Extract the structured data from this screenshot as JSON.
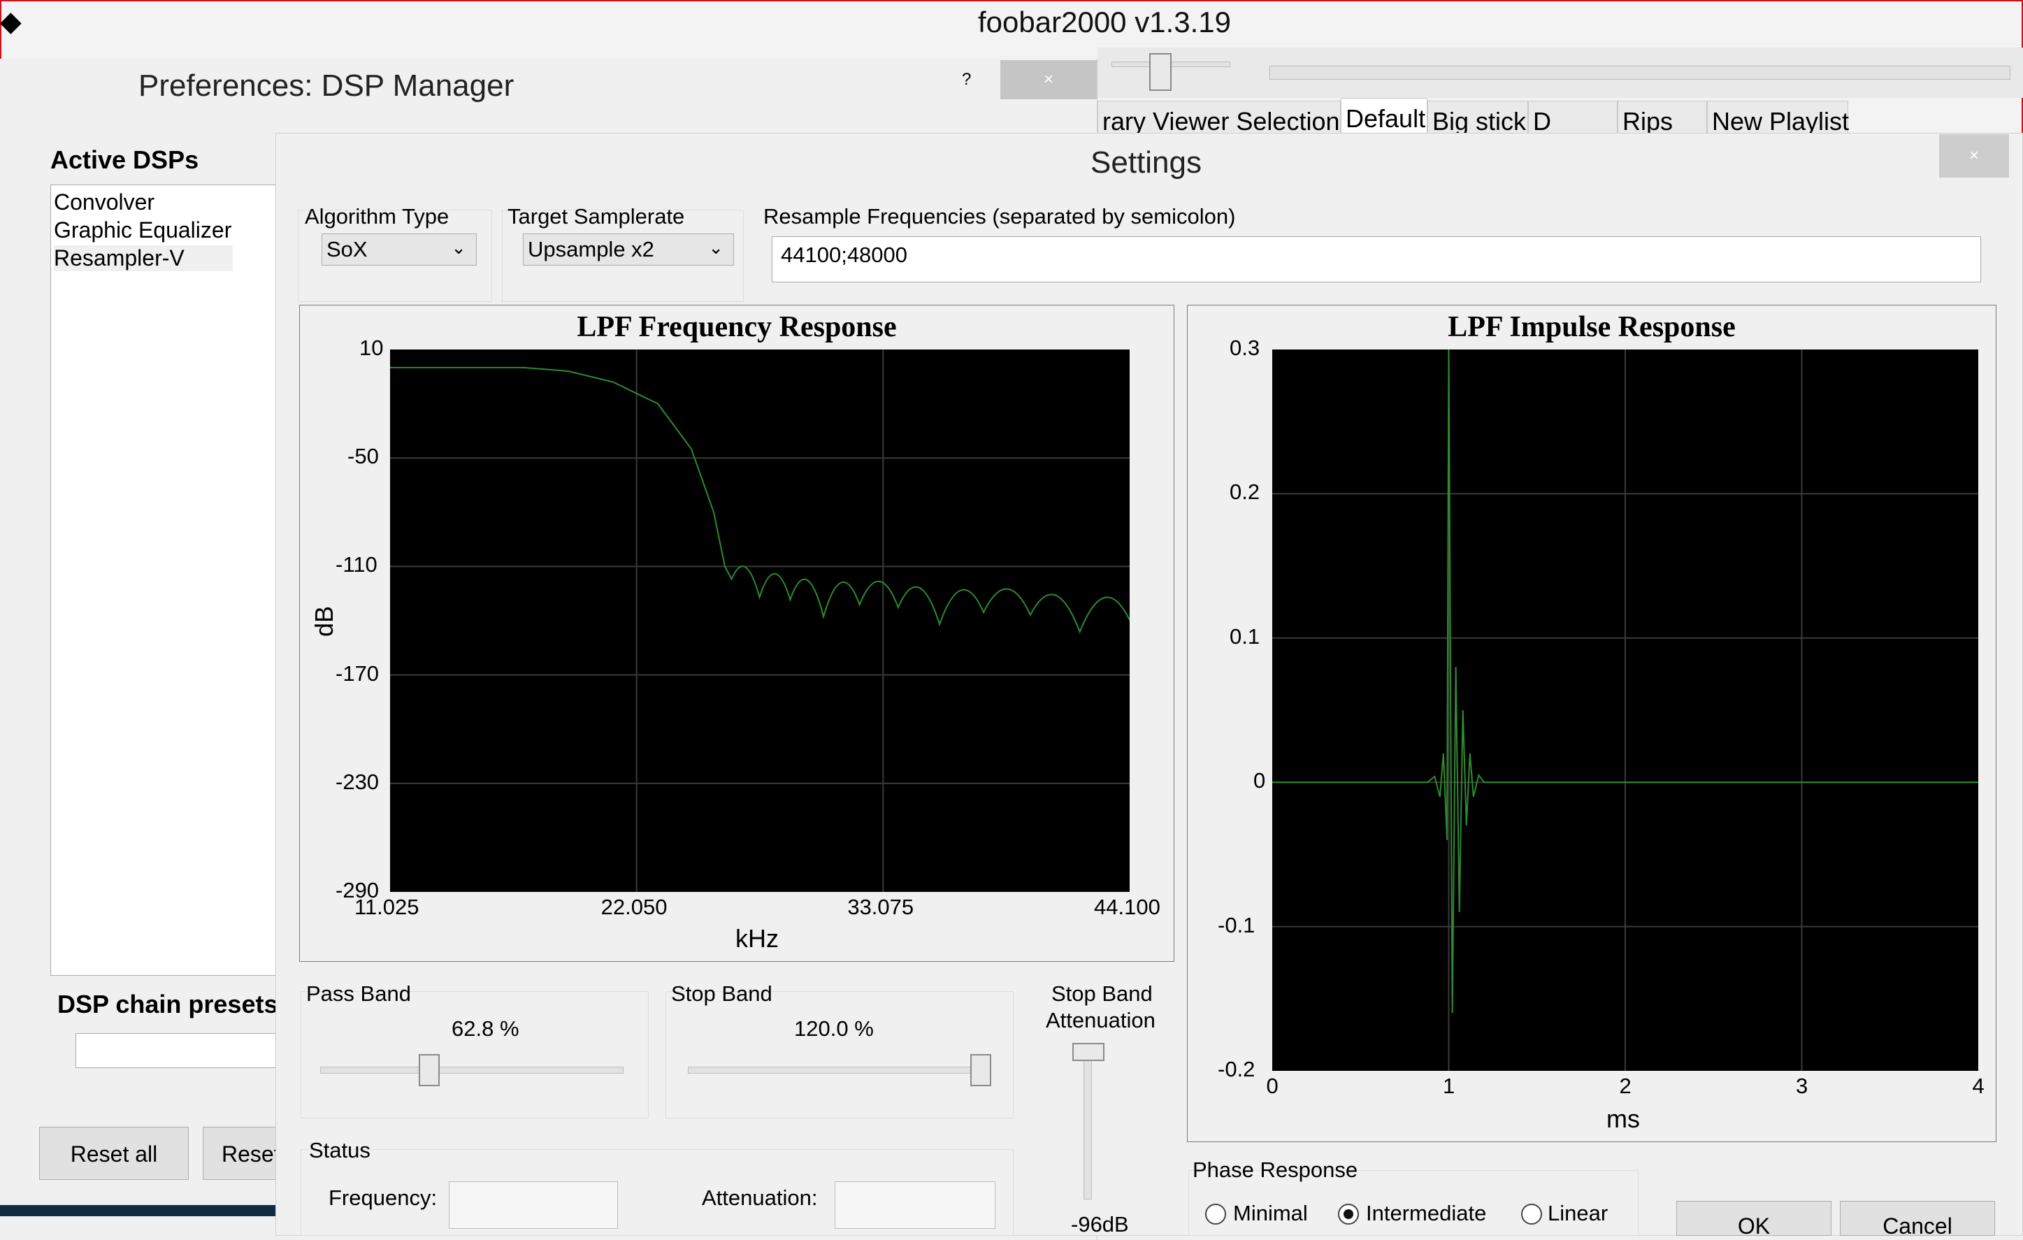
{
  "app": {
    "title": "foobar2000 v1.3.19"
  },
  "playlist_tabs": [
    "rary Viewer Selection",
    "Default",
    "Big stick",
    "D",
    "Rips",
    "New Playlist"
  ],
  "prefs": {
    "title": "Preferences: DSP Manager",
    "help": "?",
    "close": "×",
    "active_dsps_label": "Active DSPs",
    "active_dsps": [
      "Convolver",
      "Graphic Equalizer",
      "Resampler-V"
    ],
    "presets_label": "DSP chain presets",
    "reset_all": "Reset all",
    "reset": "Reset"
  },
  "settings": {
    "title": "Settings",
    "close": "×",
    "algorithm_label": "Algorithm Type",
    "algorithm_value": "SoX",
    "target_label": "Target Samplerate",
    "target_value": "Upsample x2",
    "resample_label": "Resample Frequencies (separated by semicolon)",
    "resample_value": "44100;48000",
    "pass_band_label": "Pass Band",
    "pass_band_value": "62.8 %",
    "pass_band_level": 0.35,
    "stop_band_label": "Stop Band",
    "stop_band_value": "120.0 %",
    "stop_band_level": 1.0,
    "attenuation_label_1": "Stop Band",
    "attenuation_label_2": "Attenuation",
    "attenuation_value": "-96dB",
    "status_label": "Status",
    "frequency_label": "Frequency:",
    "attenuation_field_label": "Attenuation:",
    "phase_label": "Phase Response",
    "phase_options": [
      "Minimal",
      "Intermediate",
      "Linear"
    ],
    "phase_selected": "Intermediate",
    "ok": "OK",
    "cancel": "Cancel"
  },
  "chart_data": [
    {
      "type": "line",
      "title": "LPF Frequency Response",
      "xlabel": "kHz",
      "ylabel": "dB",
      "xlim": [
        11.025,
        44.1
      ],
      "ylim": [
        -290,
        10
      ],
      "x_ticks": [
        "11.025",
        "22.050",
        "33.075",
        "44.100"
      ],
      "y_ticks": [
        "10",
        "-50",
        "-110",
        "-170",
        "-230",
        "-290"
      ],
      "series": [
        {
          "color": "#2e8b2e",
          "x": [
            11.025,
            17.0,
            19.0,
            21.0,
            23.0,
            24.5,
            25.5,
            26.0,
            26.3
          ],
          "y": [
            0,
            0,
            -2,
            -8,
            -20,
            -45,
            -80,
            -110,
            -117
          ]
        }
      ],
      "grid": true
    },
    {
      "type": "line",
      "title": "LPF Impulse Response",
      "xlabel": "ms",
      "ylabel": "",
      "xlim": [
        0,
        4
      ],
      "ylim": [
        -0.2,
        0.3
      ],
      "x_ticks": [
        "0",
        "1",
        "2",
        "3",
        "4"
      ],
      "y_ticks": [
        "0.3",
        "0.2",
        "0.1",
        "0",
        "-0.1",
        "-0.2"
      ],
      "series": [
        {
          "color": "#2e8b2e",
          "x": [
            0,
            0.88,
            0.92,
            0.95,
            0.97,
            0.99,
            1.0,
            1.02,
            1.04,
            1.06,
            1.08,
            1.1,
            1.12,
            1.14,
            1.17,
            1.2,
            4
          ],
          "y": [
            0,
            0,
            0.004,
            -0.01,
            0.02,
            -0.04,
            0.3,
            -0.16,
            0.08,
            -0.09,
            0.05,
            -0.03,
            0.02,
            -0.01,
            0.005,
            0,
            0
          ]
        }
      ],
      "grid": true
    }
  ]
}
